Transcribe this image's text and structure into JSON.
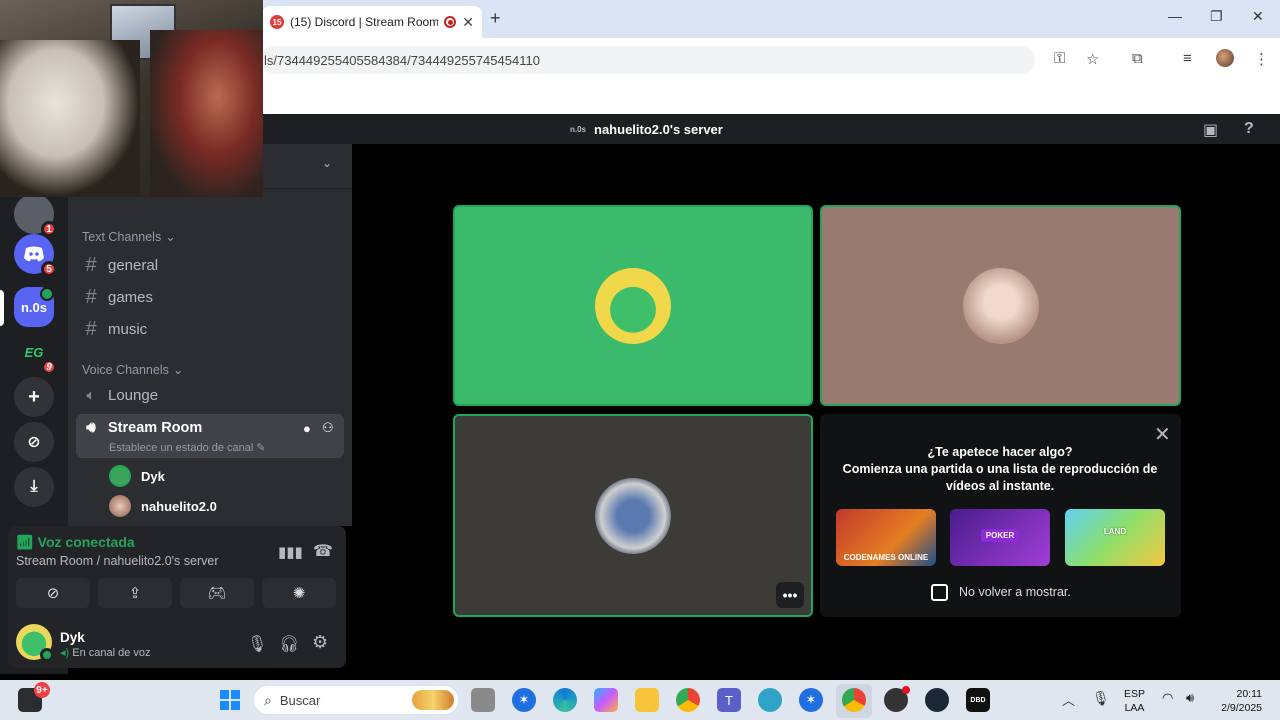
{
  "browser": {
    "tab_title": "(15) Discord | Stream Room",
    "tab_favicon_badge": "15",
    "new_tab": "+",
    "url": "ls/734449255405584384/734449255745454110"
  },
  "server": {
    "abbr": "n.0s",
    "name": "nahuelito2.0's server"
  },
  "guilds": [
    {
      "abbr": "",
      "badge": "1"
    },
    {
      "abbr": "",
      "badge": "5"
    },
    {
      "abbr": "n.0s",
      "badge": ""
    },
    {
      "abbr": "EG",
      "badge": "9"
    }
  ],
  "channels": {
    "text_category": "Text Channels",
    "text": [
      "general",
      "games",
      "music"
    ],
    "voice_category": "Voice Channels",
    "voice": [
      "Lounge"
    ],
    "active_voice": "Stream Room",
    "active_status": "Establece un estado de canal",
    "members": [
      "Dyk",
      "nahuelito2.0"
    ]
  },
  "voice_panel": {
    "status": "Voz conectada",
    "location": "Stream Room / nahuelito2.0's server"
  },
  "user": {
    "name": "Dyk",
    "status": "En canal de voz"
  },
  "activity": {
    "title": "¿Te apetece hacer algo?",
    "subtitle": "Comienza una partida o una lista de reproducción de vídeos al instante.",
    "games": [
      "CODENAMES ONLINE",
      "POKER",
      "LAND"
    ],
    "checkbox_label": "No volver a mostrar."
  },
  "taskbar": {
    "search_placeholder": "Buscar",
    "notif_badge": "9+",
    "lang": "ESP",
    "lang_sub": "LAA",
    "time": "20:11",
    "date": "2/9/2025"
  },
  "colors": {
    "green": "#23a559",
    "tile_green": "#3aba6a",
    "tile_brown": "#987a70",
    "tile_dark": "#3c3b36",
    "blurple": "#5865f2"
  }
}
